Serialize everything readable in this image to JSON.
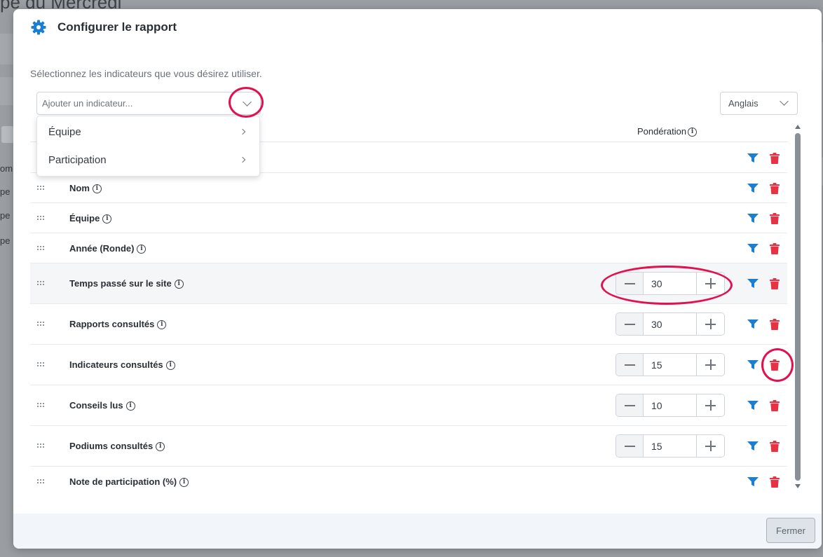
{
  "background": {
    "title": "pe du Mercredi",
    "side_texts": [
      "om",
      "pe",
      "pe",
      "pe"
    ]
  },
  "modal": {
    "title": "Configurer le rapport",
    "intro": "Sélectionnez les indicateurs que vous désirez utiliser.",
    "indicator_select": {
      "placeholder": "Ajouter un indicateur..."
    },
    "language_select": {
      "value": "Anglais"
    },
    "dropdown": {
      "items": [
        {
          "label": "Équipe"
        },
        {
          "label": "Participation"
        }
      ]
    },
    "table": {
      "header": {
        "ponderation": "Pondération"
      },
      "rows": [
        {
          "label": "",
          "weight": null
        },
        {
          "label": "Nom",
          "weight": null
        },
        {
          "label": "Équipe",
          "weight": null
        },
        {
          "label": "Année (Ronde)",
          "weight": null
        },
        {
          "label": "Temps passé sur le site",
          "weight": "30"
        },
        {
          "label": "Rapports consultés",
          "weight": "30"
        },
        {
          "label": "Indicateurs consultés",
          "weight": "15"
        },
        {
          "label": "Conseils lus",
          "weight": "10"
        },
        {
          "label": "Podiums consultés",
          "weight": "15"
        },
        {
          "label": "Note de participation (%)",
          "weight": null
        }
      ]
    },
    "footer": {
      "close_label": "Fermer"
    }
  },
  "colors": {
    "accent_blue": "#1a7fd1",
    "delete_red": "#e53245",
    "annotation": "#e0114e"
  },
  "icons": {
    "header": "gear-icon",
    "row_drag": "drag-handle-icon",
    "row_filter": "filter-icon",
    "row_delete": "trash-icon",
    "info": "info-icon"
  }
}
